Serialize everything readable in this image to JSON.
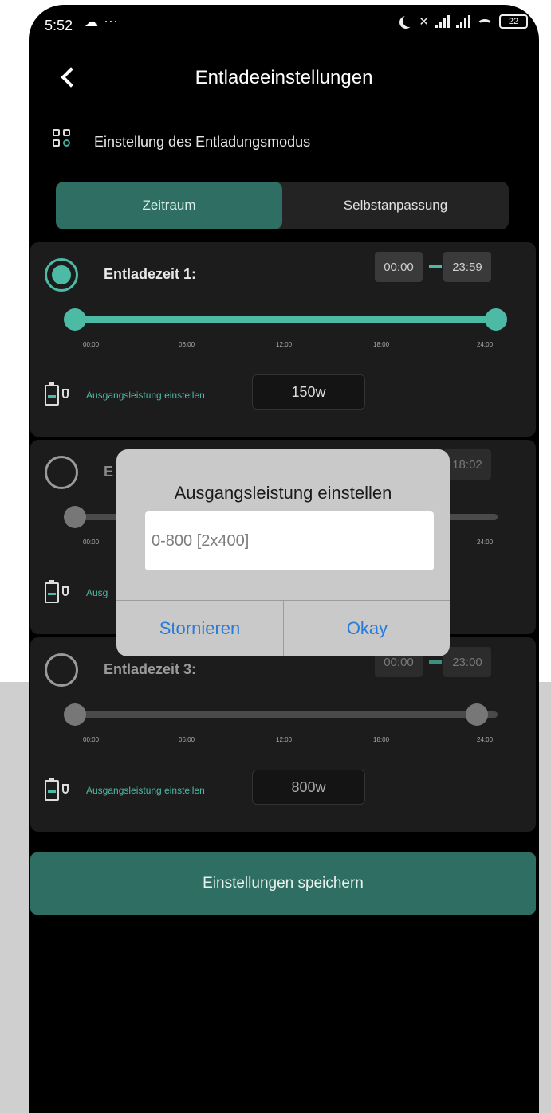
{
  "status_bar": {
    "time": "5:52",
    "dots": "···",
    "battery": "22"
  },
  "header": {
    "title": "Entladeeinstellungen"
  },
  "mode": {
    "label": "Einstellung des Entladungsmodus",
    "tabs": [
      "Zeitraum",
      "Selbstanpassung"
    ],
    "active_tab": "Zeitraum"
  },
  "cards": [
    {
      "label": "Entladezeit 1:",
      "start": "00:00",
      "end": "23:59",
      "selected": true,
      "power_label": "Ausgangsleistung einstellen",
      "power": "150w",
      "ticks": [
        "00:00",
        "06:00",
        "12:00",
        "18:00",
        "24:00"
      ]
    },
    {
      "label_visible": "E",
      "end": "18:02",
      "selected": false,
      "power_label_visible": "Ausg",
      "ticks": [
        "00:00",
        "24:00"
      ]
    },
    {
      "label": "Entladezeit 3:",
      "start": "00:00",
      "end": "23:00",
      "selected": false,
      "power_label": "Ausgangsleistung einstellen",
      "power": "800w",
      "ticks": [
        "00:00",
        "06:00",
        "12:00",
        "18:00",
        "24:00"
      ]
    }
  ],
  "save_button": "Einstellungen speichern",
  "dialog": {
    "title": "Ausgangsleistung einstellen",
    "placeholder": "0-800 [2x400]",
    "cancel": "Stornieren",
    "ok": "Okay"
  },
  "colors": {
    "accent": "#4dbaa6",
    "accent_dark": "#2e6e63",
    "background": "#000000",
    "dialog_bg": "#c9c9c9",
    "dialog_button": "#2a7bd8"
  }
}
